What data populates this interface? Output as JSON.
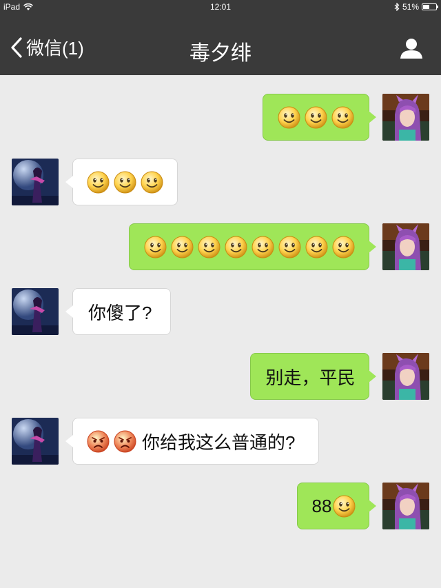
{
  "status_bar": {
    "device": "iPad",
    "time": "12:01",
    "battery": "51%",
    "battery_level": 0.51
  },
  "nav": {
    "back_label": "微信(1)",
    "title": "毒夕绯"
  },
  "messages": [
    {
      "side": "out",
      "emojis": [
        "smile",
        "smile",
        "smile"
      ],
      "text": ""
    },
    {
      "side": "in",
      "emojis": [
        "smile",
        "smile",
        "smile"
      ],
      "text": ""
    },
    {
      "side": "out",
      "emojis": [
        "smile",
        "smile",
        "smile",
        "smile",
        "smile",
        "smile",
        "smile",
        "smile"
      ],
      "text": ""
    },
    {
      "side": "in",
      "emojis": [],
      "text": "你傻了?"
    },
    {
      "side": "out",
      "emojis": [],
      "text": "别走，平民"
    },
    {
      "side": "in",
      "emojis": [
        "angry",
        "angry"
      ],
      "text": "你给我这么普通的?"
    },
    {
      "side": "out",
      "prefix": "88",
      "emojis": [
        "smile"
      ],
      "text": ""
    }
  ],
  "colors": {
    "nav_bg": "#3a3a3a",
    "chat_bg": "#ebebeb",
    "outgoing_bubble": "#9fe658",
    "incoming_bubble": "#ffffff"
  }
}
